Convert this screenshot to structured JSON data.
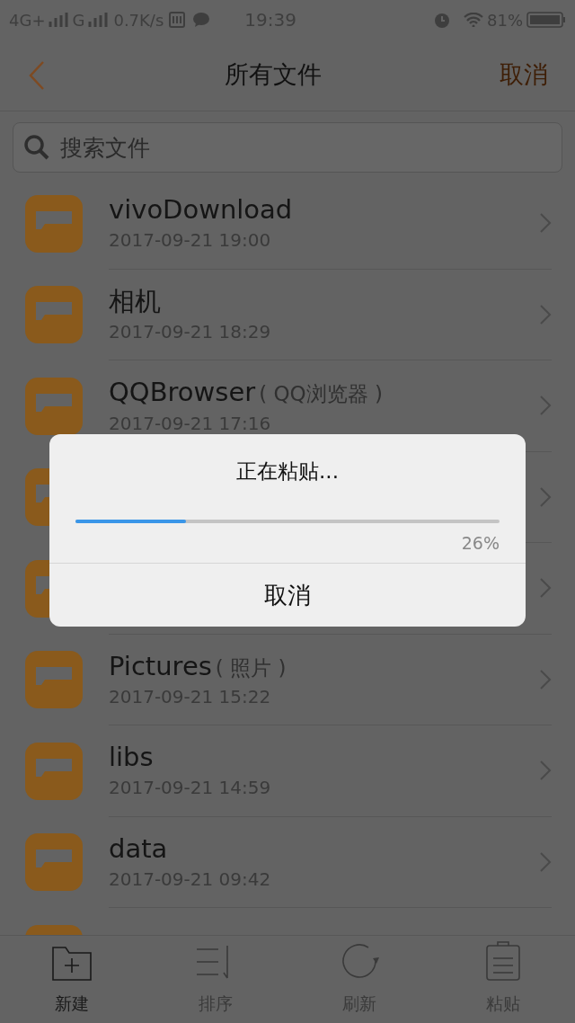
{
  "status_bar": {
    "left": [
      "4G+",
      "G",
      "0.7K/s"
    ],
    "time": "19:39",
    "battery": "81%"
  },
  "header": {
    "title": "所有文件",
    "action": "取消"
  },
  "search": {
    "placeholder": "搜索文件"
  },
  "files": [
    {
      "kind": "folder",
      "name": "vivoDownload",
      "date": "2017-09-21 19:00"
    },
    {
      "kind": "folder",
      "name": "相机",
      "date": "2017-09-21 18:29"
    },
    {
      "kind": "folder",
      "name": "QQBrowser",
      "note": "( QQ浏览器 )",
      "date": "2017-09-21 17:16"
    },
    {
      "kind": "folder"
    },
    {
      "kind": "folder"
    },
    {
      "kind": "folder",
      "name": "Pictures",
      "note": "( 照片 )",
      "date": "2017-09-21 15:22"
    },
    {
      "kind": "folder",
      "name": "libs",
      "date": "2017-09-21 14:59"
    },
    {
      "kind": "folder",
      "name": "data",
      "date": "2017-09-21 09:42"
    },
    {
      "kind": "folder"
    }
  ],
  "toolbar": [
    {
      "kind": "new",
      "label": "新建",
      "disabled": false
    },
    {
      "kind": "sort",
      "label": "排序",
      "disabled": true
    },
    {
      "kind": "refresh",
      "label": "刷新",
      "disabled": true
    },
    {
      "kind": "paste",
      "label": "粘贴",
      "disabled": true
    }
  ],
  "dialog": {
    "title": "正在粘贴...",
    "level": 0.26,
    "reading": "26%",
    "button": "取消"
  }
}
